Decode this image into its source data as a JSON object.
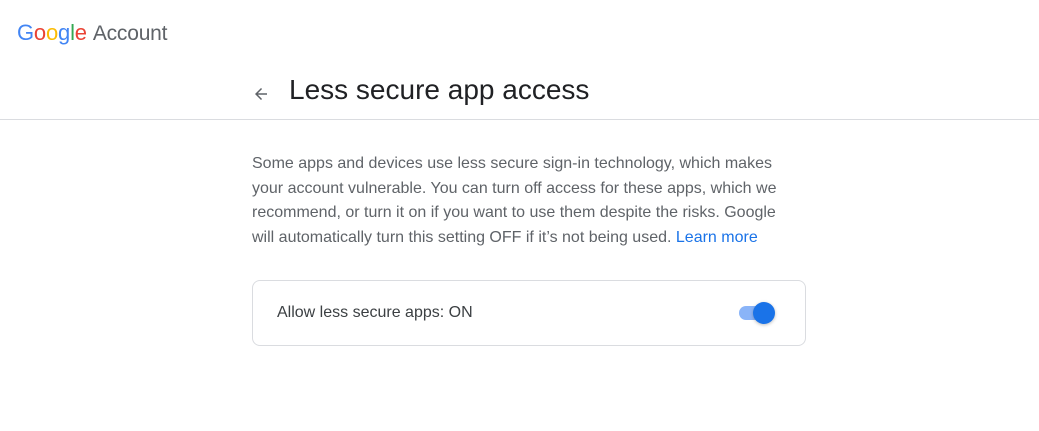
{
  "brand": {
    "letters": [
      {
        "ch": "G",
        "color": "#4285F4"
      },
      {
        "ch": "o",
        "color": "#EA4335"
      },
      {
        "ch": "o",
        "color": "#FBBC05"
      },
      {
        "ch": "g",
        "color": "#4285F4"
      },
      {
        "ch": "l",
        "color": "#34A853"
      },
      {
        "ch": "e",
        "color": "#EA4335"
      }
    ],
    "product": "Account"
  },
  "header": {
    "back_icon": "arrow-back-icon",
    "title": "Less secure app access"
  },
  "main": {
    "description": "Some apps and devices use less secure sign-in technology, which makes your account vulnerable. You can turn off access for these apps, which we recommend, or turn it on if you want to use them despite the risks. Google will automatically turn this setting OFF if it’s not being used.",
    "learn_more": "Learn more",
    "setting": {
      "label": "Allow less secure apps: ON",
      "enabled": true
    }
  },
  "colors": {
    "accent": "#1a73e8",
    "track_on": "#8ab4f8",
    "divider": "#dadce0"
  }
}
